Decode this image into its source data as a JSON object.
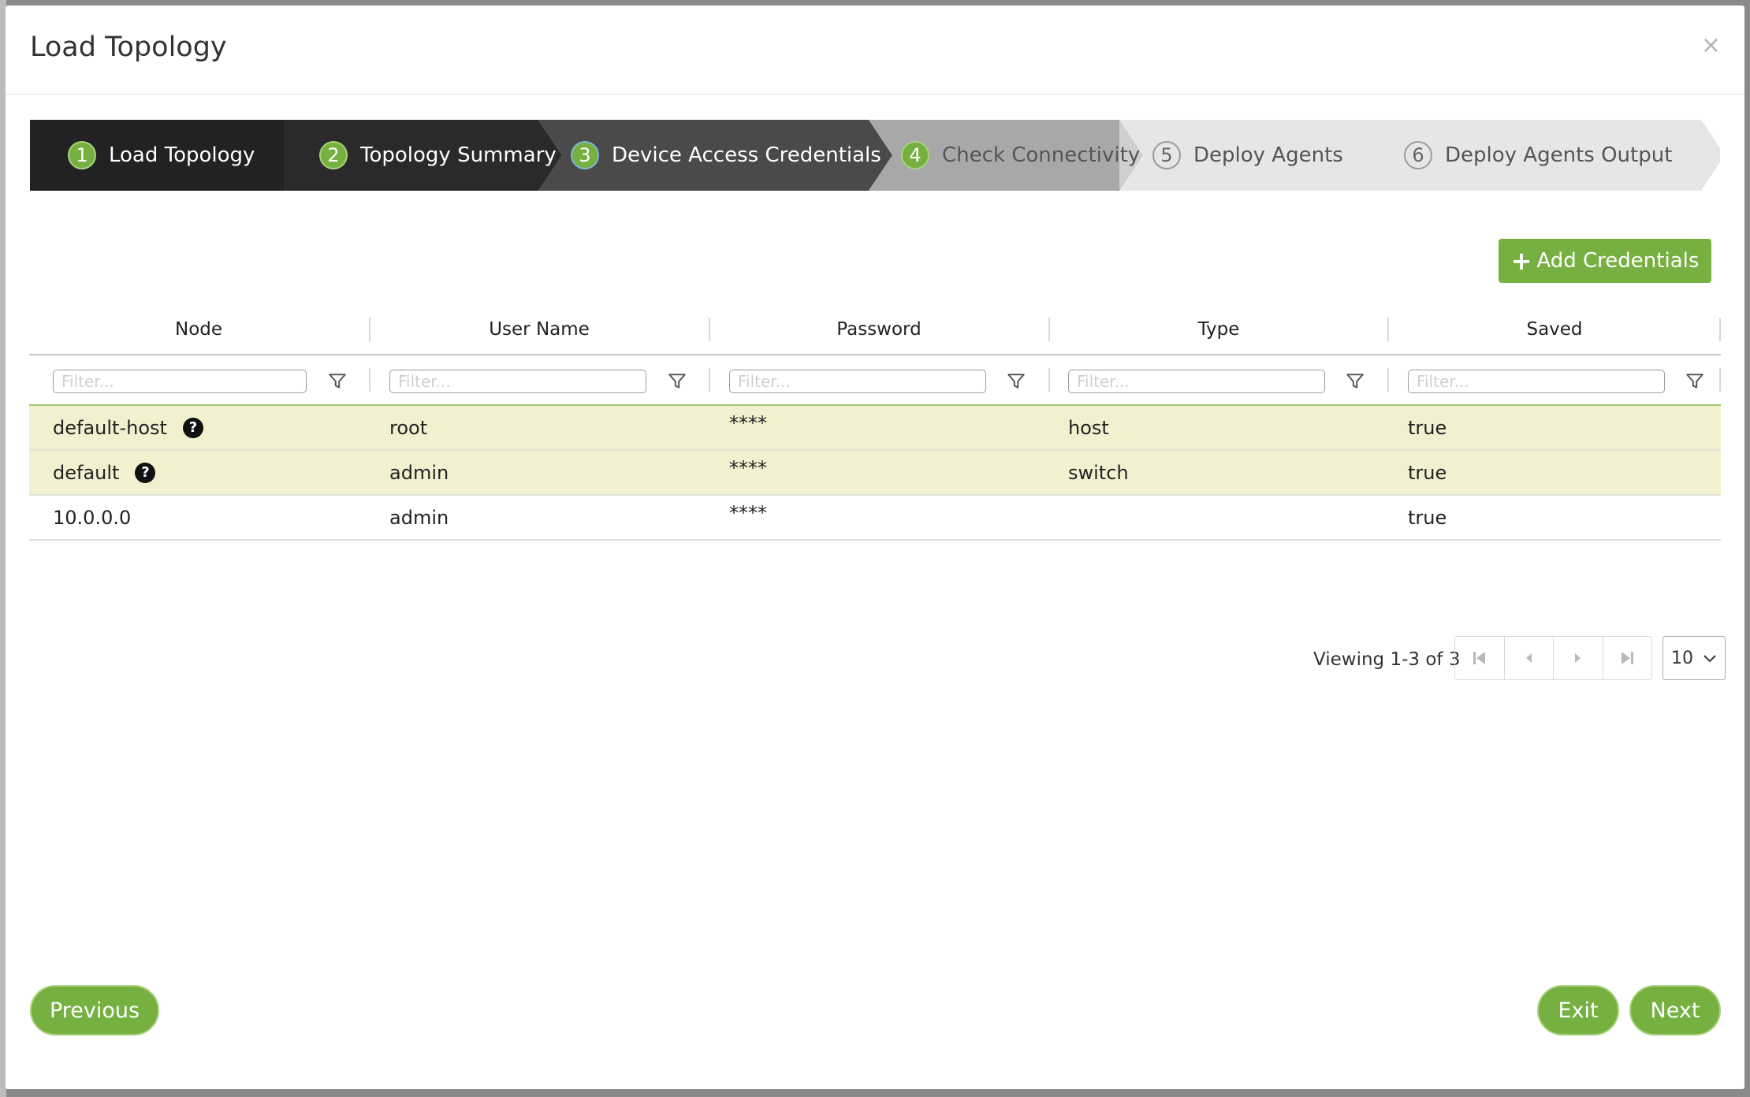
{
  "modal": {
    "title": "Load Topology",
    "close_glyph": "×"
  },
  "wizard": {
    "steps": [
      {
        "num": "1",
        "label": "Load Topology"
      },
      {
        "num": "2",
        "label": "Topology Summary"
      },
      {
        "num": "3",
        "label": "Device Access Credentials"
      },
      {
        "num": "4",
        "label": "Check Connectivity"
      },
      {
        "num": "5",
        "label": "Deploy Agents"
      },
      {
        "num": "6",
        "label": "Deploy Agents Output"
      }
    ],
    "colors": {
      "done": "#222222",
      "current": "#4a4a4a",
      "next": "#a8a8a8",
      "pending": "#e6e6e6"
    }
  },
  "toolbar": {
    "add_label": "Add Credentials",
    "add_icon": "plus-icon"
  },
  "grid": {
    "columns": [
      "Node",
      "User Name",
      "Password",
      "Type",
      "Saved"
    ],
    "filter_placeholder": "Filter...",
    "rows": [
      {
        "node": "default-host",
        "user": "root",
        "password": "****",
        "type": "host",
        "saved": "true",
        "help": "?"
      },
      {
        "node": "default",
        "user": "admin",
        "password": "****",
        "type": "switch",
        "saved": "true",
        "help": "?"
      },
      {
        "node": "10.0.0.0",
        "user": "admin",
        "password": "****",
        "type": "",
        "saved": "true"
      }
    ]
  },
  "pager": {
    "viewing": "Viewing 1-3 of 3",
    "page_size": "10"
  },
  "footer": {
    "previous": "Previous",
    "exit": "Exit",
    "next": "Next"
  },
  "theme": {
    "accent": "#76b041",
    "row_highlight": "#f3f0d0"
  }
}
